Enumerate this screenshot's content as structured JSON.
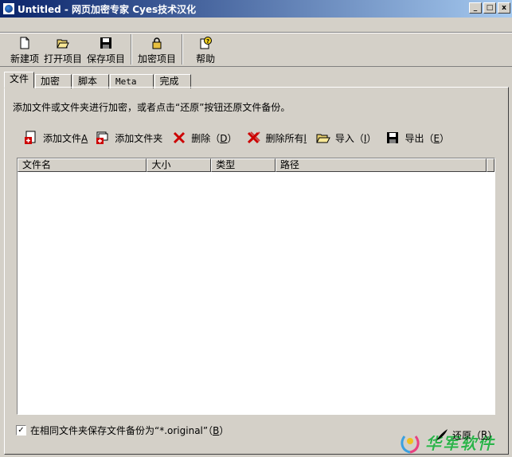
{
  "window": {
    "title": "Untitled - 网页加密专家 Cyes技术汉化",
    "minimize": "_",
    "maximize": "□",
    "close": "x"
  },
  "toolbar": {
    "new": "新建项",
    "open": "打开项目",
    "save": "保存项目",
    "encrypt": "加密项目",
    "help": "帮助"
  },
  "tabs": [
    {
      "label": "文件",
      "active": true
    },
    {
      "label": "加密"
    },
    {
      "label": "脚本"
    },
    {
      "label": "Meta"
    },
    {
      "label": "完成"
    }
  ],
  "instruction": "添加文件或文件夹进行加密，或者点击“还原”按钮还原文件备份。",
  "actions": {
    "add_file": {
      "label": "添加文件",
      "hotkey": "A"
    },
    "add_folder": {
      "label": "添加文件夹",
      "hotkey": ""
    },
    "delete": {
      "label": "删除（",
      "hotkey": "D",
      "suffix": "）"
    },
    "delete_all": {
      "label": "删除所有",
      "hotkey": "l",
      "suffix": ""
    },
    "import": {
      "label": "导入（",
      "hotkey": "I",
      "suffix": "）"
    },
    "export": {
      "label": "导出（",
      "hotkey": "E",
      "suffix": "）"
    }
  },
  "list": {
    "columns": [
      "文件名",
      "大小",
      "类型",
      "路径"
    ],
    "rows": []
  },
  "backup_option": {
    "checked": true,
    "check_glyph": "✓",
    "label": "在相同文件夹保存文件备份为“*.original”（",
    "hotkey": "B",
    "suffix": "）"
  },
  "restore_button": {
    "label": "还原（",
    "hotkey": "R",
    "suffix": "）"
  },
  "watermark": {
    "text": "华军软件"
  },
  "colors": {
    "title_start": "#0a246a",
    "title_end": "#a6caf0",
    "face": "#d4d0c8",
    "delete_red": "#cc0000",
    "watermark_green": "#2db34a"
  }
}
